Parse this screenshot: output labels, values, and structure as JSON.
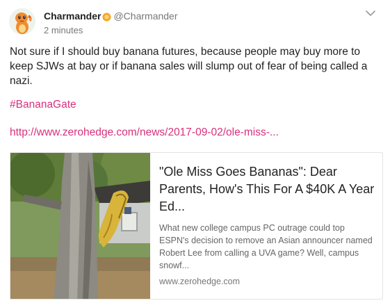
{
  "author": {
    "display_name": "Charmander",
    "handle": "@Charmander",
    "verified_badge_icon": "verified-badge-icon",
    "avatar_icon": "charmander-avatar-icon"
  },
  "timestamp": "2 minutes",
  "menu_icon": "chevron-down-icon",
  "post": {
    "text": "Not sure if I should buy banana futures, because people may buy more to keep SJWs at bay or if banana sales will slump out of fear of being called a nazi.",
    "hashtag": "#BananaGate",
    "link": "http://www.zerohedge.com/news/2017-09-02/ole-miss-..."
  },
  "link_card": {
    "title": "\"Ole Miss Goes Bananas\": Dear Parents, How's This For A $40K A Year Ed...",
    "description": "What new college campus PC outrage could top ESPN's decision to remove an Asian announcer named Robert Lee from calling a UVA game? Well, campus snowf...",
    "domain": "www.zerohedge.com"
  },
  "colors": {
    "accent": "#d9307c",
    "verified": "#f5a623",
    "muted": "#777777"
  }
}
